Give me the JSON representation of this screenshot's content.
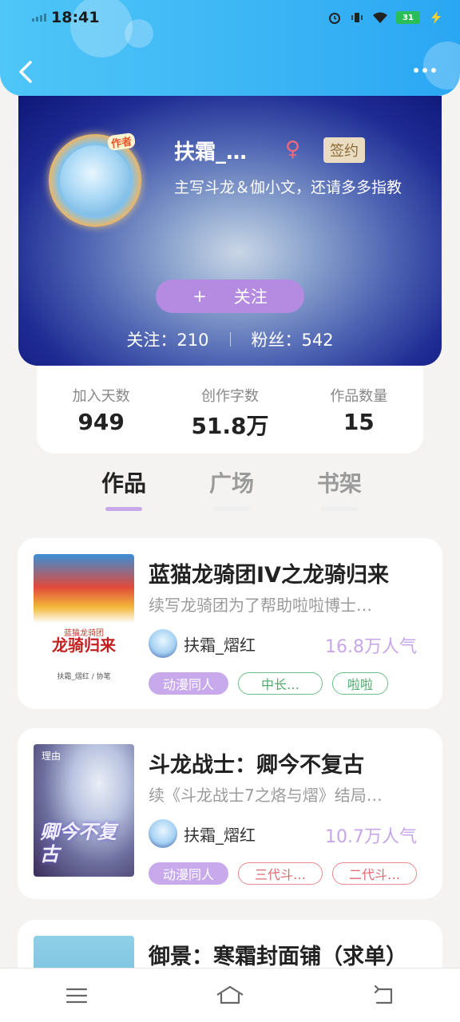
{
  "status": {
    "time": "18:41",
    "battery": "31"
  },
  "profile": {
    "avatar_tag": "作者",
    "name": "扶霜_…",
    "gender_icon": "♀",
    "signed_badge": "签约",
    "bio": "主写斗龙＆伽小文，还请多多指教",
    "follow_button": {
      "plus": "+",
      "label": "关注"
    },
    "following": "关注：210",
    "fans": "粉丝：542"
  },
  "stats": [
    {
      "label": "加入天数",
      "value": "949"
    },
    {
      "label": "创作字数",
      "value": "51.8万"
    },
    {
      "label": "作品数量",
      "value": "15"
    }
  ],
  "tabs": [
    {
      "label": "作品",
      "active": true
    },
    {
      "label": "广场",
      "active": false
    },
    {
      "label": "书架",
      "active": false
    }
  ],
  "books": [
    {
      "title": "蓝猫龙骑团IV之龙骑归来",
      "desc": "续写龙骑团为了帮助啦啦博士…",
      "author": "扶霜_熠红",
      "popularity": "16.8万人气",
      "tags": [
        "动漫同人",
        "中长…",
        "啦啦"
      ],
      "cover_text": [
        "蓝猫龙骑团",
        "龙骑归来",
        "扶霜_熠红 / 协笔"
      ]
    },
    {
      "title": "斗龙战士：卿今不复古",
      "desc": "续《斗龙战士7之烙与熠》结局…",
      "author": "扶霜_熠红",
      "popularity": "10.7万人气",
      "tags": [
        "动漫同人",
        "三代斗…",
        "二代斗…"
      ],
      "cover_text": [
        "理由",
        "卿今不复古"
      ]
    },
    {
      "title": "御景：寒霜封面铺（求单）"
    }
  ],
  "colors": {
    "accent": "#c7a9ec",
    "header": "#3bb4f5"
  }
}
